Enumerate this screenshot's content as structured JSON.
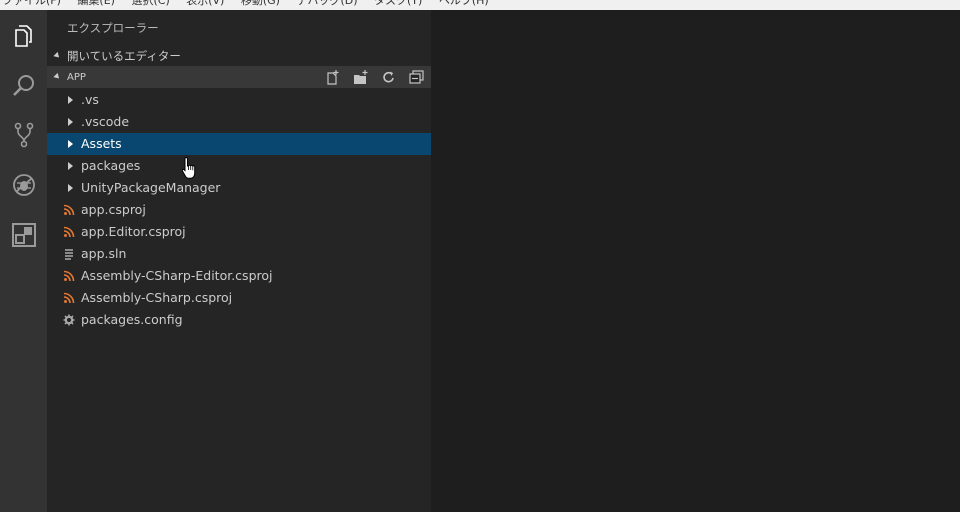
{
  "menubar": {
    "items": [
      "ファイル(F)",
      "編集(E)",
      "選択(C)",
      "表示(V)",
      "移動(G)",
      "デバッグ(D)",
      "タスク(T)",
      "ヘルプ(H)"
    ]
  },
  "activity_bar": {
    "icons": [
      "explorer-icon",
      "search-icon",
      "source-control-icon",
      "debug-icon",
      "extensions-icon"
    ]
  },
  "sidebar": {
    "title": "エクスプローラー",
    "open_editors_label": "開いているエディター",
    "folder_label": "APP",
    "actions": [
      "new-file-icon",
      "new-folder-icon",
      "refresh-icon",
      "collapse-all-icon"
    ],
    "items": [
      {
        "label": ".vs",
        "type": "folder"
      },
      {
        "label": ".vscode",
        "type": "folder"
      },
      {
        "label": "Assets",
        "type": "folder",
        "selected": true
      },
      {
        "label": "packages",
        "type": "folder"
      },
      {
        "label": "UnityPackageManager",
        "type": "folder"
      },
      {
        "label": "app.csproj",
        "type": "rss-file"
      },
      {
        "label": "app.Editor.csproj",
        "type": "rss-file"
      },
      {
        "label": "app.sln",
        "type": "lines-file"
      },
      {
        "label": "Assembly-CSharp-Editor.csproj",
        "type": "rss-file"
      },
      {
        "label": "Assembly-CSharp.csproj",
        "type": "rss-file"
      },
      {
        "label": "packages.config",
        "type": "gear-file"
      }
    ]
  },
  "colors": {
    "activity_bg": "#333333",
    "sidebar_bg": "#252526",
    "selection_bg": "#094771",
    "editor_bg": "#1e1e1e",
    "rss_orange": "#e37933"
  }
}
